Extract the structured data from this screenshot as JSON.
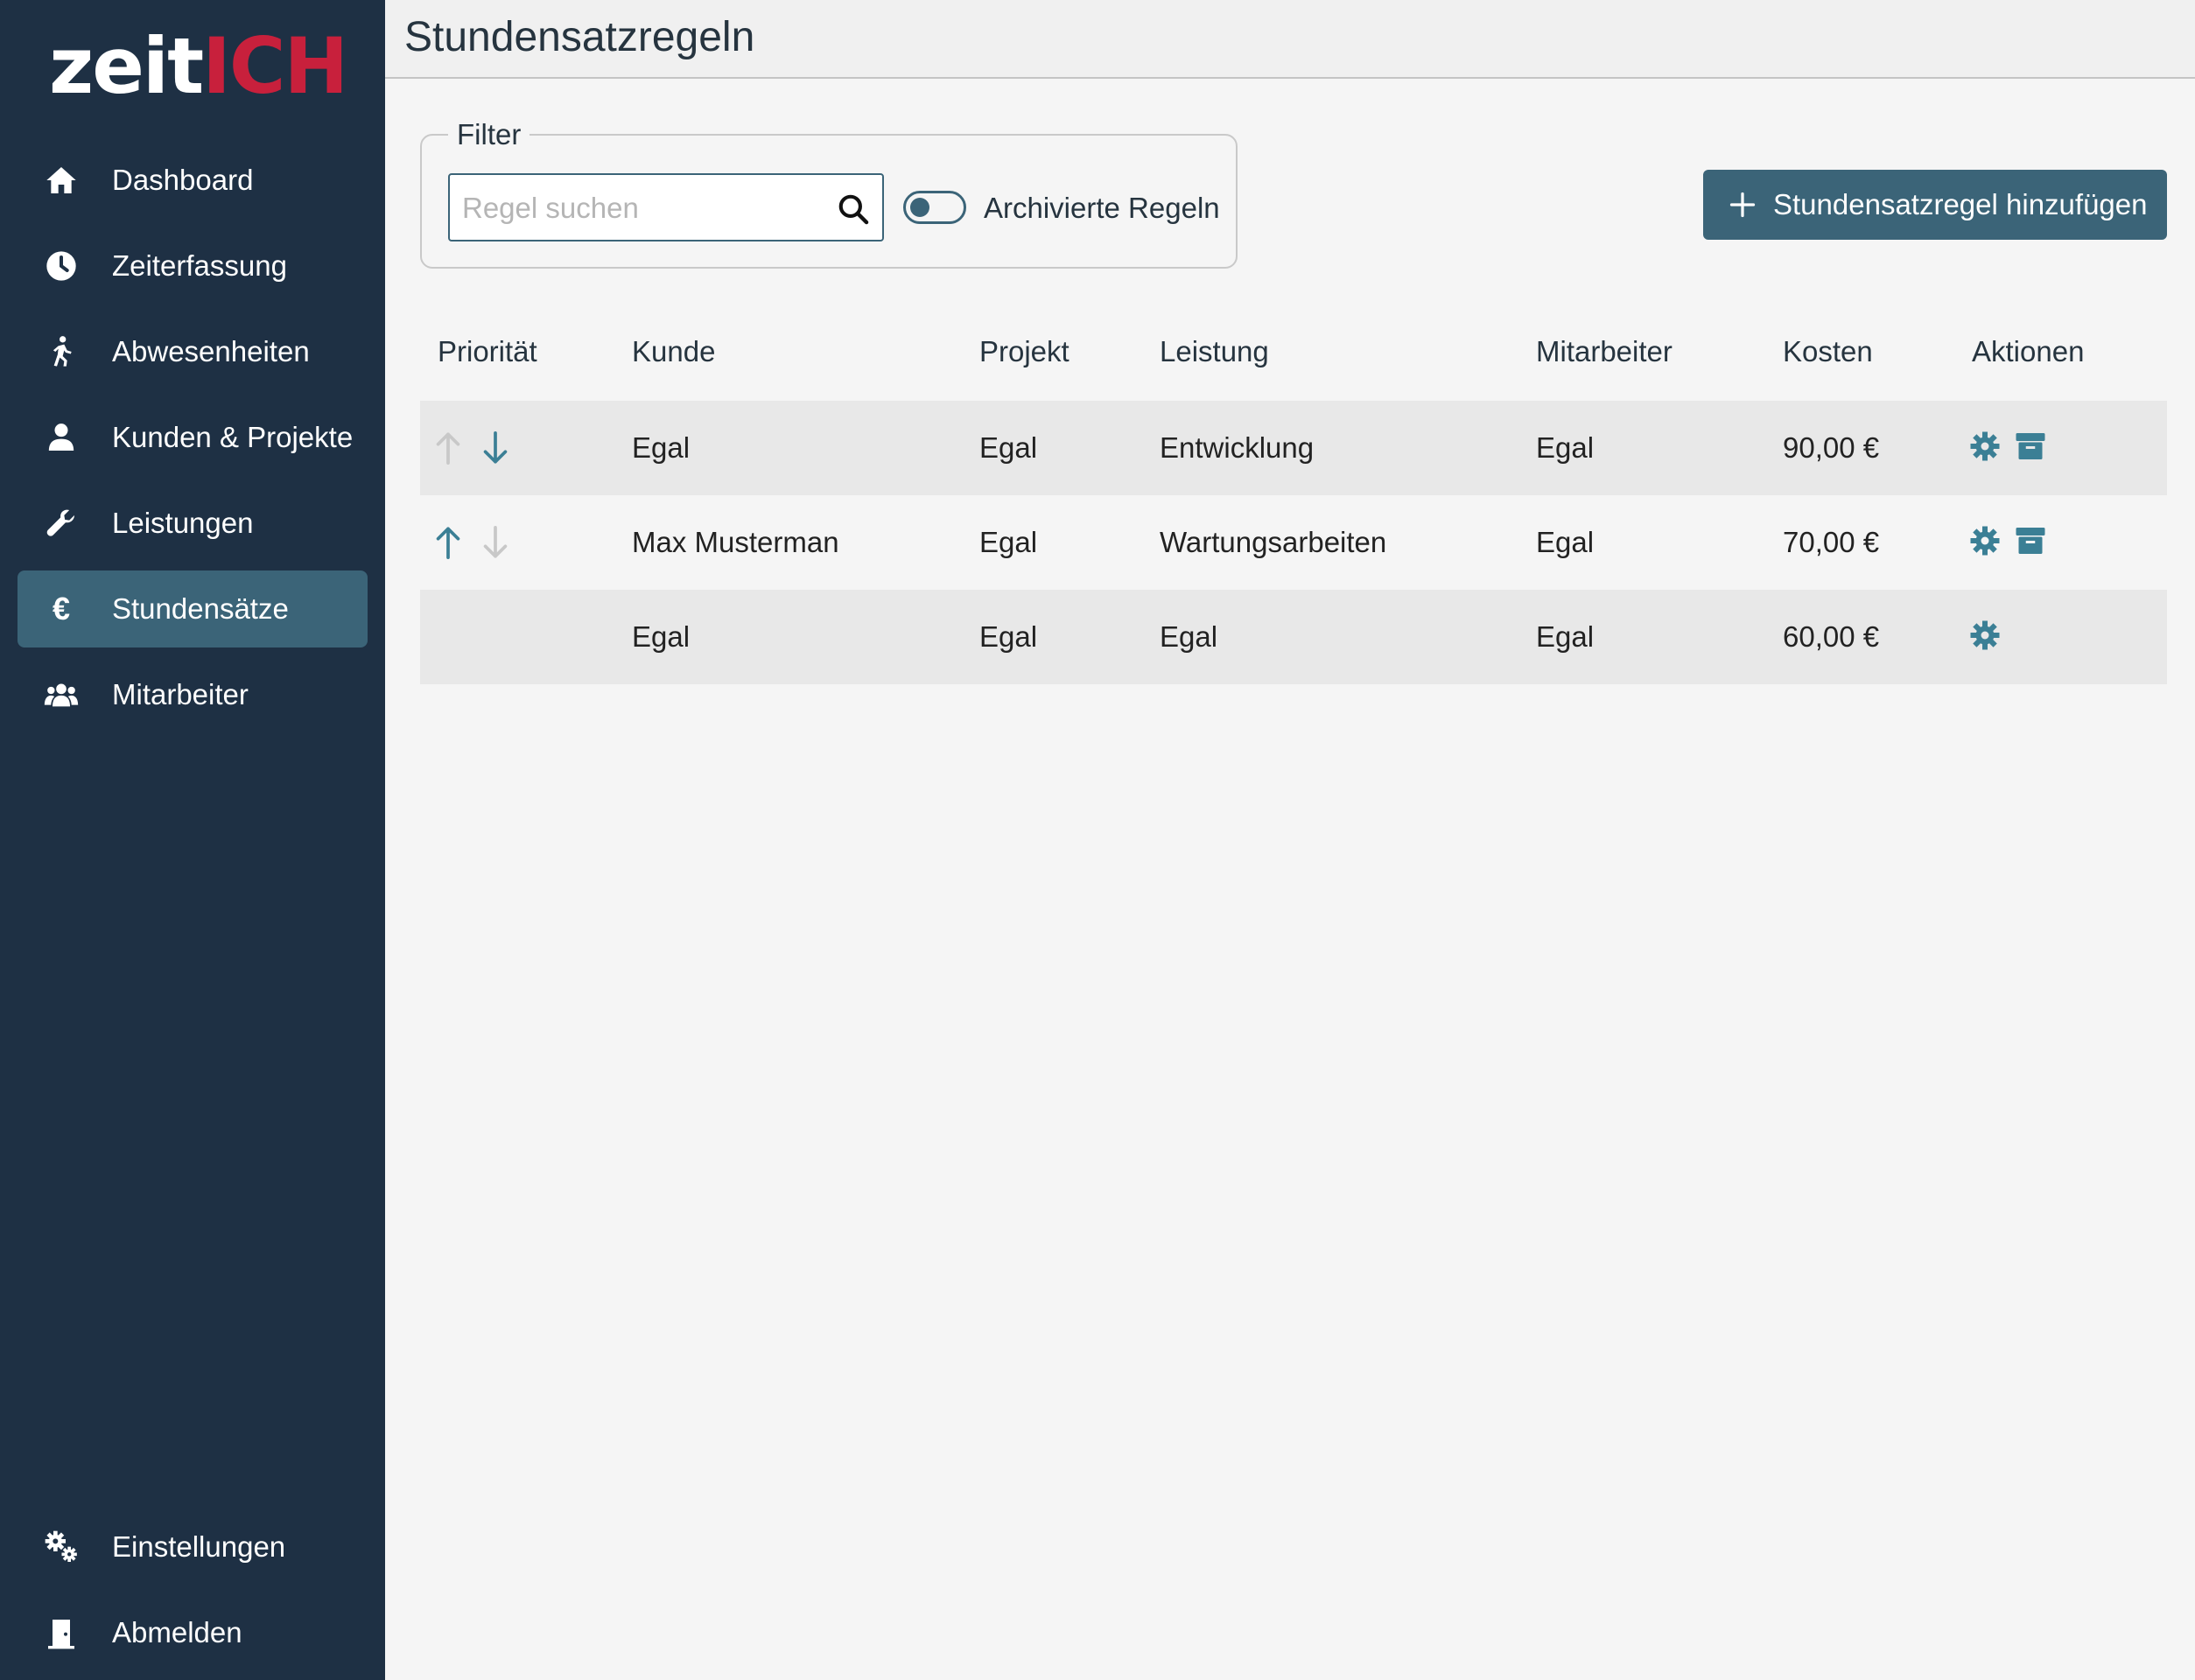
{
  "app": {
    "logo_part1": "zeit",
    "logo_part2": "ICH",
    "brand_color": "#c8203c",
    "sidebar_bg": "#1e3044",
    "accent": "#3b6478"
  },
  "sidebar": {
    "items": [
      {
        "label": "Dashboard",
        "icon": "home-icon"
      },
      {
        "label": "Zeiterfassung",
        "icon": "clock-icon"
      },
      {
        "label": "Abwesenheiten",
        "icon": "walking-person-icon"
      },
      {
        "label": "Kunden & Projekte",
        "icon": "user-icon"
      },
      {
        "label": "Leistungen",
        "icon": "wrench-icon"
      },
      {
        "label": "Stundensätze",
        "icon": "euro-icon",
        "active": true
      },
      {
        "label": "Mitarbeiter",
        "icon": "users-icon"
      }
    ],
    "bottom": [
      {
        "label": "Einstellungen",
        "icon": "gears-icon"
      },
      {
        "label": "Abmelden",
        "icon": "door-icon"
      }
    ],
    "euro_glyph": "€"
  },
  "header": {
    "title": "Stundensatzregeln"
  },
  "filter": {
    "legend": "Filter",
    "search_placeholder": "Regel suchen",
    "search_value": "",
    "toggle_label": "Archivierte Regeln",
    "toggle_on": false
  },
  "toolbar": {
    "add_label": "Stundensatzregel hinzufügen"
  },
  "table": {
    "columns": [
      "Priorität",
      "Kunde",
      "Projekt",
      "Leistung",
      "Mitarbeiter",
      "Kosten",
      "Aktionen"
    ],
    "rows": [
      {
        "kunde": "Egal",
        "projekt": "Egal",
        "leistung": "Entwicklung",
        "mitarbeiter": "Egal",
        "kosten": "90,00 €",
        "up_enabled": false,
        "down_enabled": true,
        "archivable": true
      },
      {
        "kunde": "Max Musterman",
        "projekt": "Egal",
        "leistung": "Wartungsarbeiten",
        "mitarbeiter": "Egal",
        "kosten": "70,00 €",
        "up_enabled": true,
        "down_enabled": false,
        "archivable": true
      },
      {
        "kunde": "Egal",
        "projekt": "Egal",
        "leistung": "Egal",
        "mitarbeiter": "Egal",
        "kosten": "60,00 €",
        "up_enabled": false,
        "down_enabled": false,
        "archivable": false,
        "fixed": true
      }
    ]
  }
}
